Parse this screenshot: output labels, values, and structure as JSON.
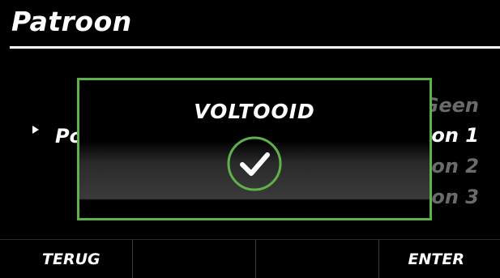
{
  "header": {
    "title": "Patroon"
  },
  "list": {
    "selected_left": "Po",
    "items_right": [
      "Geen",
      "on 1",
      "on 2",
      "on 3"
    ]
  },
  "dialog": {
    "title": "VOLTOOID",
    "icon": "check-circle-icon"
  },
  "softkeys": {
    "back": "TERUG",
    "enter": "ENTER"
  },
  "colors": {
    "accent": "#5fb24a",
    "background": "#000000",
    "dim_text": "#6b6b6b"
  }
}
